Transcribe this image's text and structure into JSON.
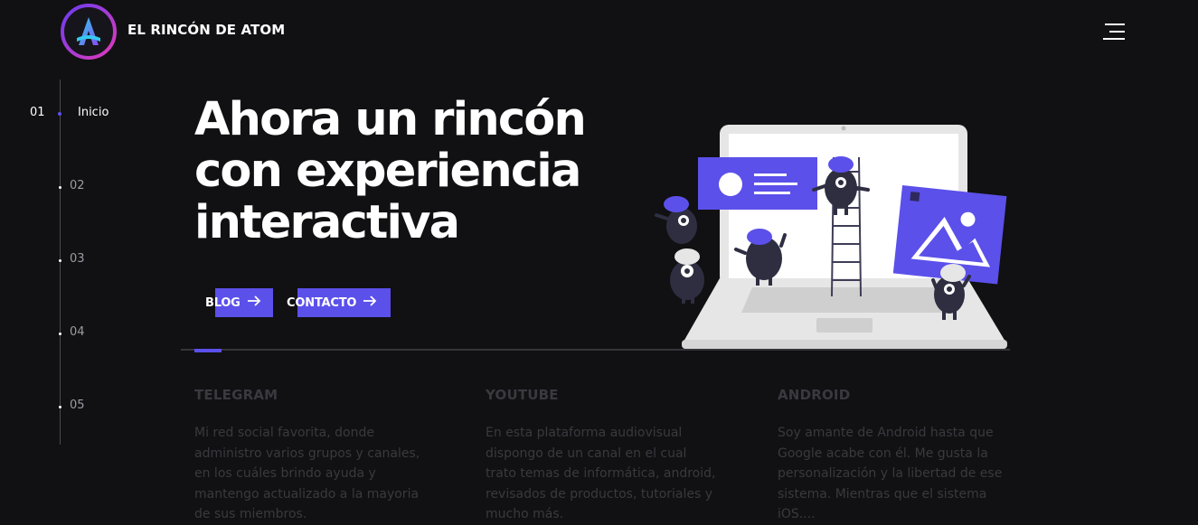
{
  "header": {
    "brand": "EL RINCÓN DE ATOM",
    "logo_letter": "A",
    "menu_icon": "hamburger-menu-icon"
  },
  "side_nav": {
    "active": {
      "number": "01",
      "label": "Inicio"
    },
    "items": [
      "02",
      "03",
      "04",
      "05"
    ]
  },
  "hero": {
    "title_lines": [
      "Ahora un rincón",
      "con experiencia",
      "interactiva"
    ],
    "buttons": {
      "blog": "BLOG",
      "contact": "CONTACTO"
    }
  },
  "cards": [
    {
      "title": "TELEGRAM",
      "text": "Mi red social favorita, donde administro varios grupos y canales, en los cuáles brindo ayuda y mantengo actualizado a la mayoria de sus miembros."
    },
    {
      "title": "YOUTUBE",
      "text": "En esta plataforma audiovisual dispongo de un canal en el cual trato temas de informática, android, revisados de productos, tutoriales y mucho más."
    },
    {
      "title": "ANDROID",
      "text": "Soy amante de Android hasta que Google acabe con él. Me gusta la personalización y la libertad de ese sistema. Mientras que el sistema iOS...."
    }
  ],
  "colors": {
    "background": "#111012",
    "accent": "#5b50ea",
    "muted_text": "#3a393f"
  }
}
